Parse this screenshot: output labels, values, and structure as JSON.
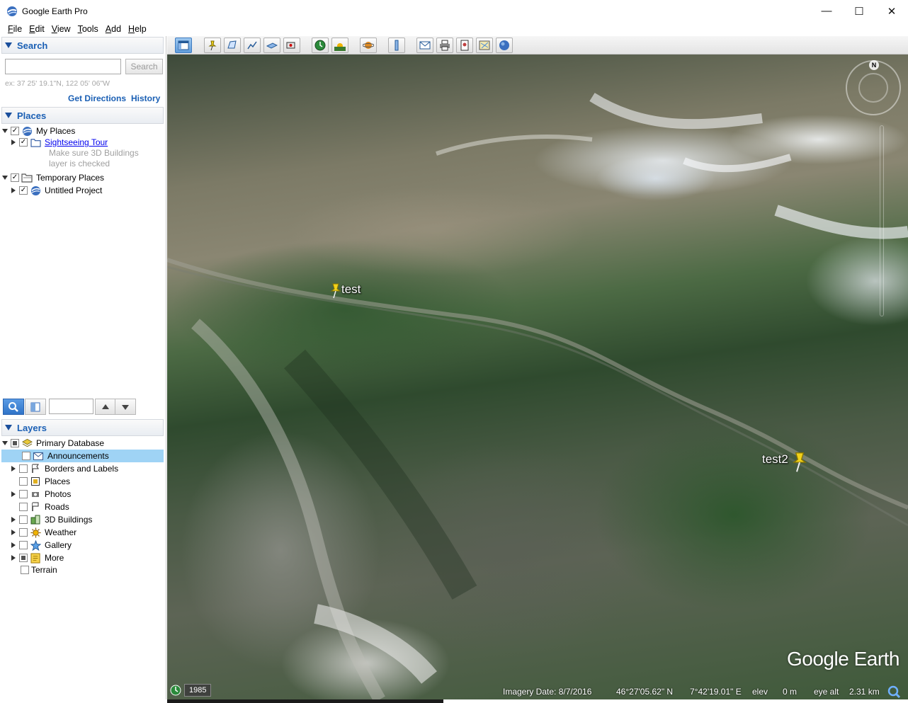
{
  "window": {
    "title": "Google Earth Pro",
    "minimize": "—",
    "maximize": "☐",
    "close": "✕"
  },
  "menu": [
    {
      "label": "File",
      "key": "F",
      "rest": "ile"
    },
    {
      "label": "Edit",
      "key": "E",
      "rest": "dit"
    },
    {
      "label": "View",
      "key": "V",
      "rest": "iew"
    },
    {
      "label": "Tools",
      "key": "T",
      "rest": "ools"
    },
    {
      "label": "Add",
      "key": "A",
      "rest": "dd"
    },
    {
      "label": "Help",
      "key": "H",
      "rest": "elp"
    }
  ],
  "search": {
    "header": "Search",
    "input_value": "",
    "button": "Search",
    "hint": "ex: 37 25' 19.1\"N, 122 05' 06\"W",
    "get_directions": "Get Directions",
    "history": "History"
  },
  "places": {
    "header": "Places",
    "my_places": "My Places",
    "sightseeing_tour": "Sightseeing Tour",
    "sightseeing_note_1": "Make sure 3D Buildings",
    "sightseeing_note_2": "layer is checked",
    "temporary_places": "Temporary Places",
    "untitled_project": "Untitled Project"
  },
  "layers": {
    "header": "Layers",
    "items": [
      {
        "label": "Primary Database",
        "icon": "layers-stack-icon",
        "checked": "partial",
        "expanded": true
      },
      {
        "label": "Announcements",
        "icon": "envelope-icon",
        "checked": "unchecked",
        "selected": true
      },
      {
        "label": "Borders and Labels",
        "icon": "flag-icon",
        "checked": "unchecked"
      },
      {
        "label": "Places",
        "icon": "places-square-icon",
        "checked": "unchecked"
      },
      {
        "label": "Photos",
        "icon": "camera-icon",
        "checked": "unchecked"
      },
      {
        "label": "Roads",
        "icon": "road-sign-icon",
        "checked": "unchecked"
      },
      {
        "label": "3D Buildings",
        "icon": "buildings-icon",
        "checked": "unchecked"
      },
      {
        "label": "Weather",
        "icon": "sun-icon",
        "checked": "unchecked"
      },
      {
        "label": "Gallery",
        "icon": "star-icon",
        "checked": "unchecked"
      },
      {
        "label": "More",
        "icon": "folder-icon",
        "checked": "partial"
      },
      {
        "label": "Terrain",
        "icon": "",
        "checked": "unchecked"
      }
    ]
  },
  "map": {
    "placemarks": [
      {
        "label": "test"
      },
      {
        "label": "test2"
      }
    ],
    "compass_letter": "N",
    "brand": "Google Earth",
    "historical_year": "1985",
    "imagery_date": "Imagery Date: 8/7/2016",
    "latitude": "46°27'05.62\" N",
    "longitude": "7°42'19.01\" E",
    "elev_label": "elev",
    "elev_value": "0 m",
    "eye_alt_label": "eye alt",
    "eye_alt_value": "2.31 km"
  },
  "colors": {
    "accent": "#1a5fb4",
    "selection": "#9fd3f5",
    "placemark": "#f2d21b"
  }
}
